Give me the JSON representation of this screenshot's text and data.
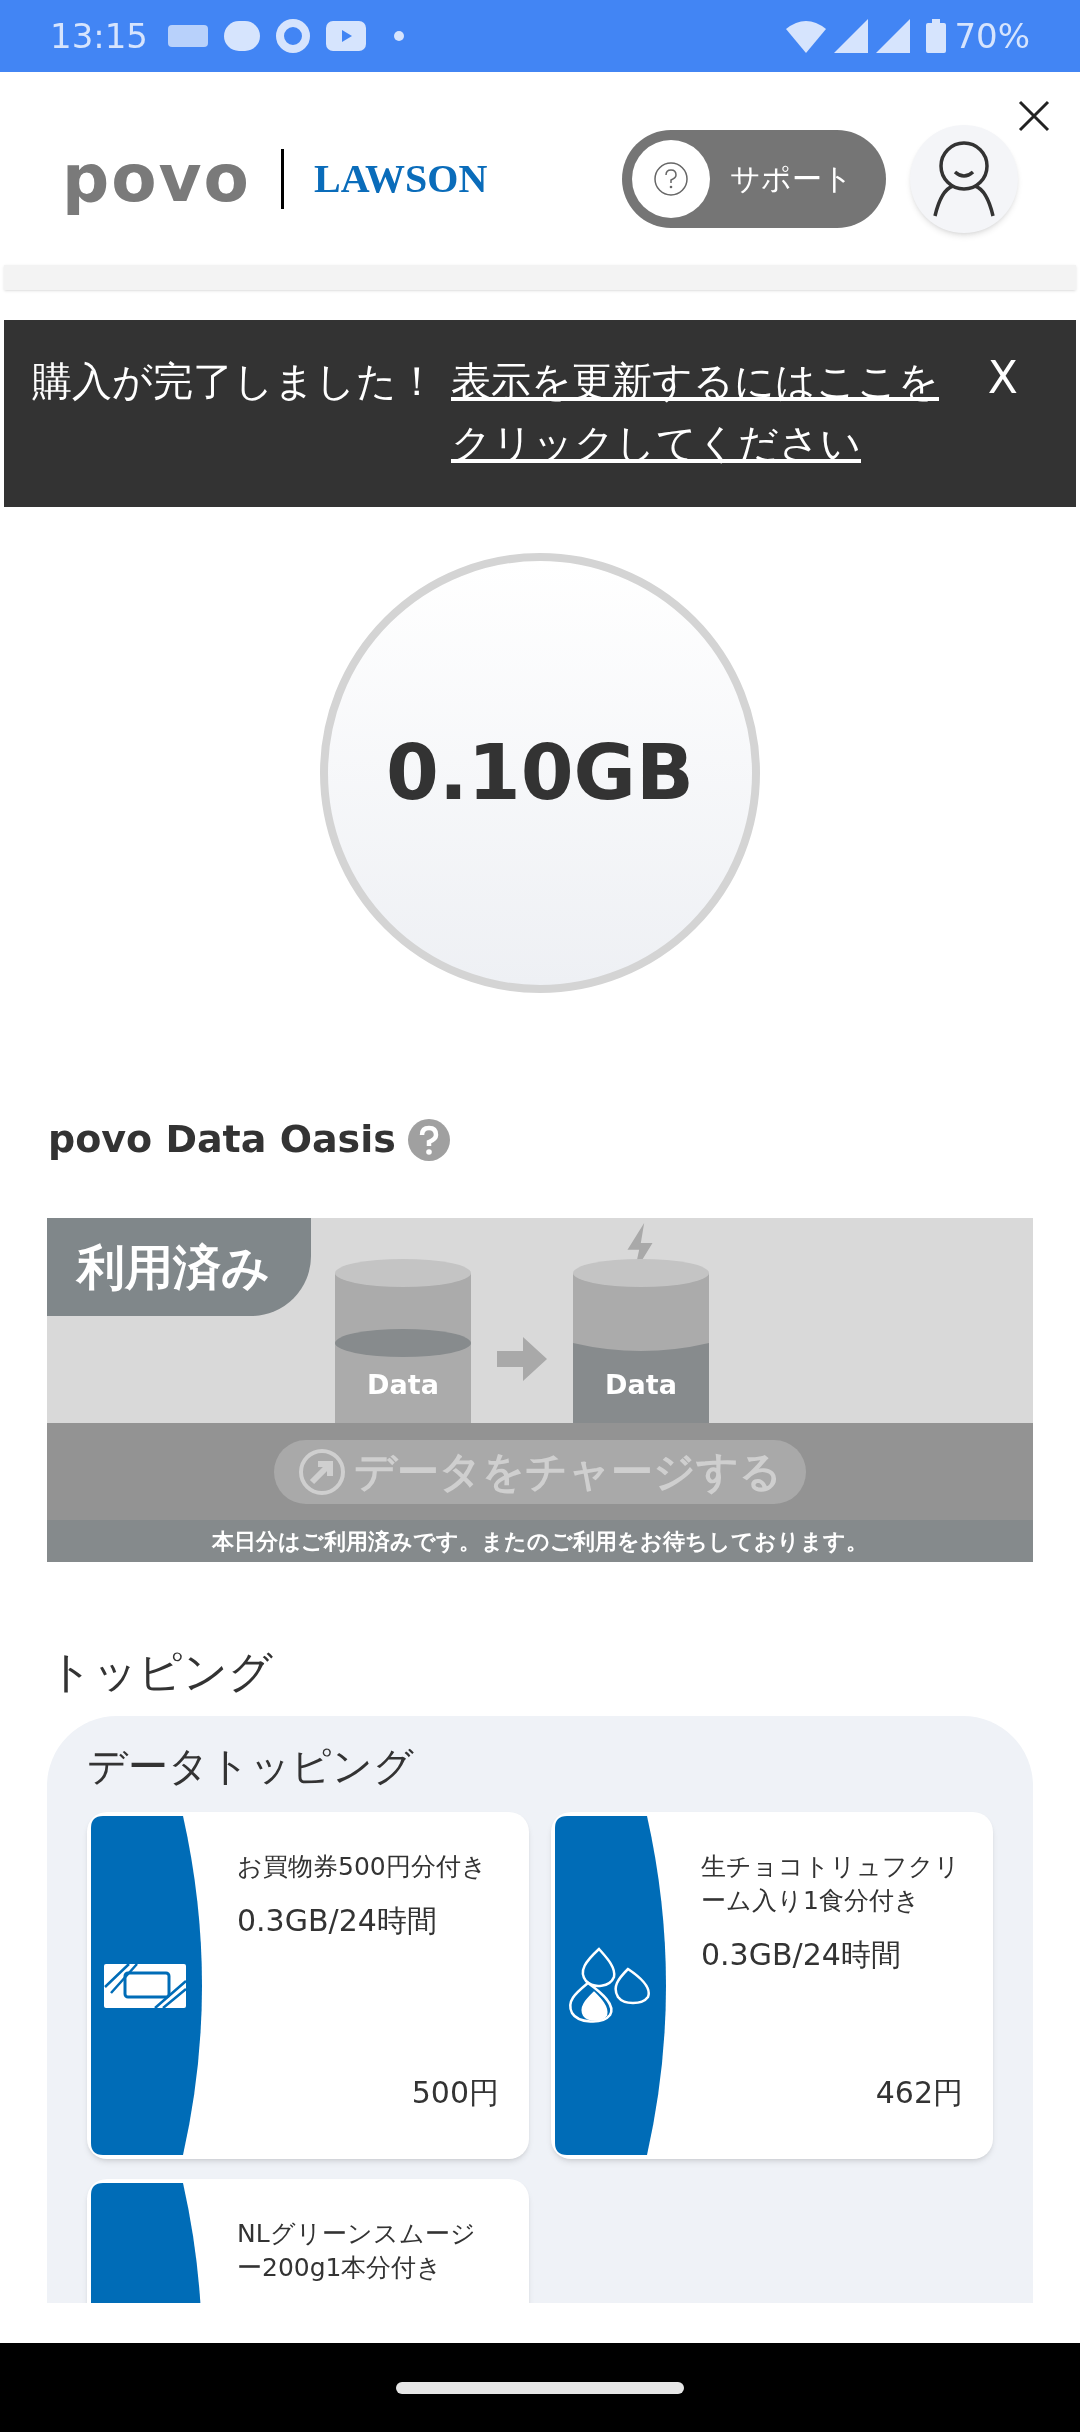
{
  "status_bar": {
    "time": "13:15",
    "battery": "70%"
  },
  "header": {
    "logos": [
      "povo",
      "LAWSON"
    ],
    "support_button": "サポート"
  },
  "notice": {
    "message": "購入が完了しました！",
    "link": "表示を更新するにはここをクリックしてください",
    "close": "X"
  },
  "data_remaining": "0.10GB",
  "oasis": {
    "title": "povo Data Oasis",
    "badge": "利用済み",
    "cylinder_labels": [
      "Data",
      "Data"
    ],
    "charge_button": "データをチャージする",
    "footer": "本日分はご利用済みです。またのご利用をお待ちしております。"
  },
  "topping": {
    "title": "トッピング",
    "section": "データトッピング",
    "items": [
      {
        "kind": "voucher",
        "name": "お買物券500円分付き",
        "data": "0.3GB/24時間",
        "price": "500円"
      },
      {
        "kind": "sweets",
        "name": "生チョコトリュフクリーム入り1食分付き",
        "data": "0.3GB/24時間",
        "price": "462円"
      },
      {
        "kind": "drink",
        "name": "NLグリーンスムージー200g1本分付き"
      }
    ]
  }
}
